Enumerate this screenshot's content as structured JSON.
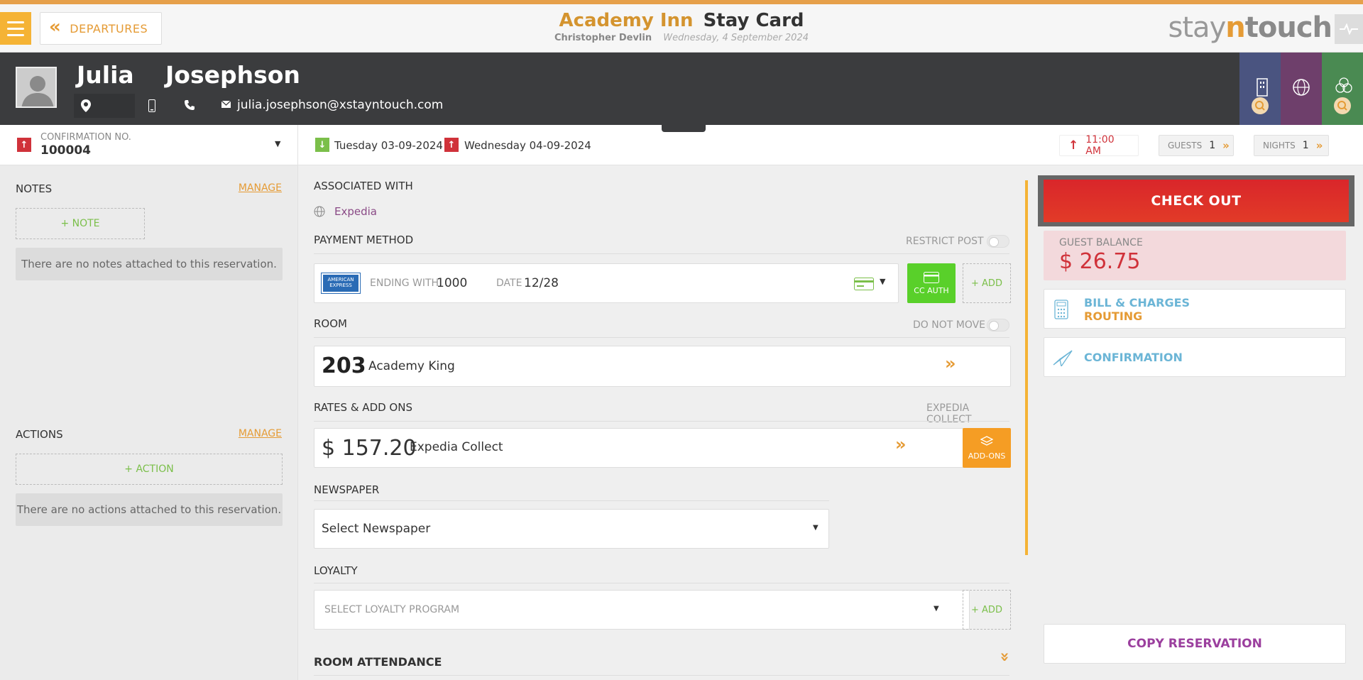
{
  "header": {
    "back_label": "DEPARTURES",
    "hotel_name": "Academy Inn",
    "page_title": "Stay Card",
    "user_name": "Christopher Devlin",
    "business_date": "Wednesday, 4 September 2024",
    "logo_prefix": "stay",
    "logo_n": "n",
    "logo_suffix": "touch"
  },
  "guest": {
    "first_name": "Julia",
    "last_name": "Josephson",
    "email": "julia.josephson@xstayntouch.com"
  },
  "reservation": {
    "confirmation_label": "CONFIRMATION NO.",
    "confirmation_number": "100004",
    "arrival": "Tuesday 03-09-2024",
    "departure": "Wednesday 04-09-2024",
    "checkout_time": "11:00 AM",
    "guests_label": "GUESTS",
    "guests_value": "1",
    "nights_label": "NIGHTS",
    "nights_value": "1"
  },
  "notes": {
    "title": "NOTES",
    "manage": "MANAGE",
    "add_label": "+ NOTE",
    "empty": "There are no notes attached to this reservation."
  },
  "actions": {
    "title": "ACTIONS",
    "manage": "MANAGE",
    "add_label": "+ ACTION",
    "empty": "There are no actions attached to this reservation."
  },
  "associated": {
    "title": "ASSOCIATED WITH",
    "value": "Expedia"
  },
  "payment": {
    "title": "PAYMENT METHOD",
    "restrict_label": "RESTRICT POST",
    "card_brand": "AMERICAN EXPRESS",
    "ending_label": "ENDING WITH",
    "ending_value": "1000",
    "date_label": "DATE",
    "date_value": "12/28",
    "cc_auth_label": "CC AUTH",
    "add_label": "+ ADD"
  },
  "room": {
    "title": "ROOM",
    "do_not_move_label": "DO NOT MOVE",
    "number": "203",
    "type": "Academy King"
  },
  "rates": {
    "title": "RATES & ADD ONS",
    "right_label": "EXPEDIA COLLECT",
    "amount": "$ 157.20",
    "rate_name": "Expedia Collect",
    "addons_label": "ADD-ONS"
  },
  "newspaper": {
    "title": "NEWSPAPER",
    "selected": "Select Newspaper"
  },
  "loyalty": {
    "title": "LOYALTY",
    "placeholder": "SELECT LOYALTY PROGRAM",
    "add_label": "+ ADD"
  },
  "room_attendance": {
    "title": "ROOM ATTENDANCE"
  },
  "sidebar_right": {
    "checkout_label": "CHECK OUT",
    "balance_label": "GUEST BALANCE",
    "balance_value": "$ 26.75",
    "bill_line1": "BILL & CHARGES",
    "bill_line2": "ROUTING",
    "confirmation_label": "CONFIRMATION",
    "copy_label": "COPY RESERVATION"
  },
  "colors": {
    "accent": "#e59b35",
    "danger": "#d0323a",
    "success": "#7bbf4a",
    "link_blue": "#6bb5d6",
    "purple": "#9b3f9e"
  }
}
